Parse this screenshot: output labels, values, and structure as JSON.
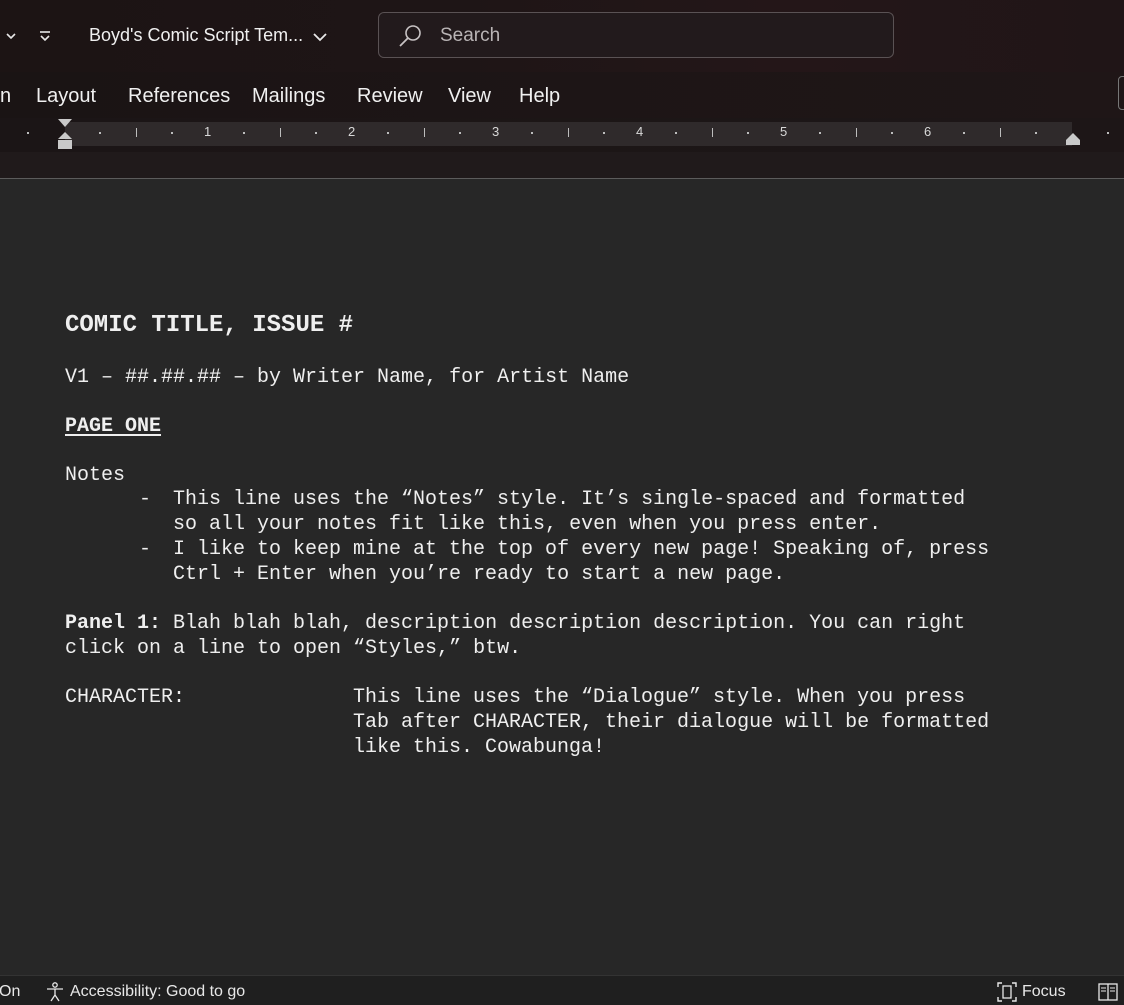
{
  "titlebar": {
    "doc_title": "Boyd's Comic Script Tem...",
    "search_placeholder": "Search"
  },
  "ribbon_tabs": [
    {
      "label": "n"
    },
    {
      "label": "Layout"
    },
    {
      "label": "References"
    },
    {
      "label": "Mailings"
    },
    {
      "label": "Review"
    },
    {
      "label": "View"
    },
    {
      "label": "Help"
    }
  ],
  "ruler": {
    "numbers": [
      "1",
      "2",
      "3",
      "4",
      "5",
      "6"
    ]
  },
  "document": {
    "title": "COMIC TITLE, ISSUE #",
    "byline": "V1 – ##.##.## – by Writer Name, for Artist Name",
    "page_heading": "PAGE ONE",
    "notes_label": "Notes",
    "notes": [
      {
        "dash": "-",
        "line1": "This line uses the “Notes” style. It’s single-spaced and formatted",
        "line2": "so all your notes fit like this, even when you press enter."
      },
      {
        "dash": "-",
        "line1": "I like to keep mine at the top of every new page! Speaking of, press",
        "line2": "Ctrl + Enter when you’re ready to start a new page."
      }
    ],
    "panel_label": "Panel 1:",
    "panel_line1": " Blah blah blah, description description description. You can right",
    "panel_line2": "click on a line to open “Styles,” btw.",
    "character": "CHARACTER:",
    "dialogue": [
      "This line uses the “Dialogue” style. When you press",
      "Tab after CHARACTER, their dialogue will be formatted",
      "like this. Cowabunga!"
    ]
  },
  "statusbar": {
    "left_fragment": "On",
    "accessibility": "Accessibility: Good to go",
    "focus": "Focus"
  }
}
